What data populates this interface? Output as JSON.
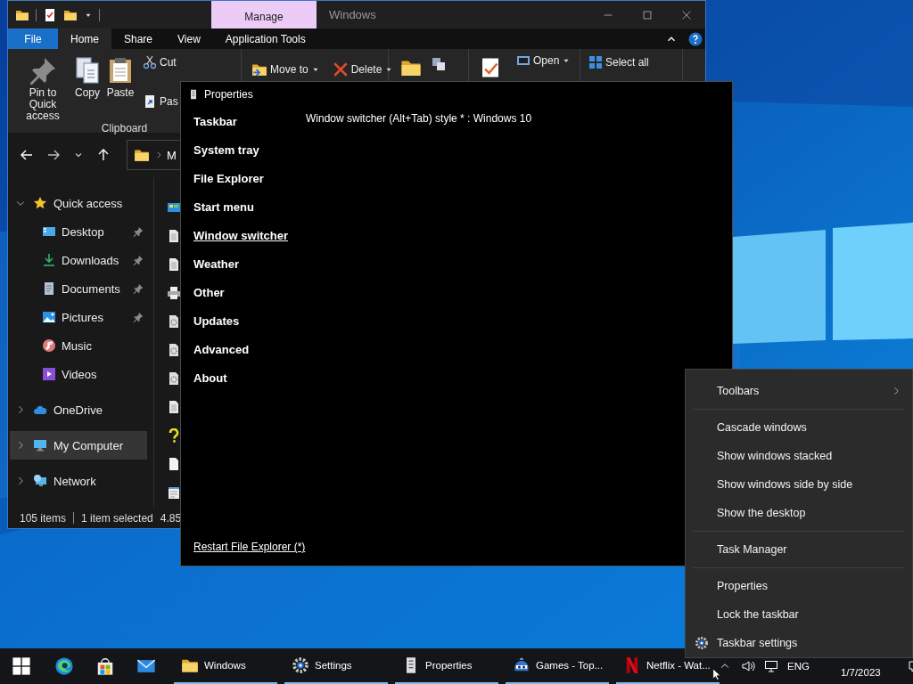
{
  "explorer": {
    "contextual_tab": "Manage",
    "title": "Windows",
    "ribbon_tabs": [
      {
        "label": "File",
        "kind": "file",
        "selected": false
      },
      {
        "label": "Home",
        "kind": "tab",
        "selected": true
      },
      {
        "label": "Share",
        "kind": "tab",
        "selected": false
      },
      {
        "label": "View",
        "kind": "tab",
        "selected": false
      },
      {
        "label": "Application Tools",
        "kind": "tab",
        "selected": false
      }
    ],
    "clipboard_group": {
      "large_buttons": [
        "Pin to Quick access",
        "Copy",
        "Paste"
      ],
      "small_buttons": [
        "Cut",
        "Pas"
      ],
      "label": "Clipboard"
    },
    "organize_buttons": [
      "Move to",
      "Delete"
    ],
    "open_buttons": [
      "Open"
    ],
    "select_buttons": [
      "Select all"
    ],
    "address": "M",
    "nav_tree": [
      {
        "label": "Quick access",
        "expanded": true,
        "selected": false,
        "children": [
          {
            "label": "Desktop",
            "pinned": true,
            "selected": false
          },
          {
            "label": "Downloads",
            "pinned": true,
            "selected": false
          },
          {
            "label": "Documents",
            "pinned": true,
            "selected": false
          },
          {
            "label": "Pictures",
            "pinned": true,
            "selected": false
          },
          {
            "label": "Music",
            "pinned": false,
            "selected": false
          },
          {
            "label": "Videos",
            "pinned": false,
            "selected": false
          }
        ]
      },
      {
        "label": "OneDrive",
        "expanded": false,
        "selected": false
      },
      {
        "label": "My Computer",
        "expanded": false,
        "selected": true
      },
      {
        "label": "Network",
        "expanded": false,
        "selected": false
      }
    ],
    "status": {
      "item_count": "105 items",
      "selection": "1 item selected",
      "size": "4.85"
    }
  },
  "properties": {
    "title": "Properties",
    "sections": [
      {
        "label": "Taskbar",
        "selected": false
      },
      {
        "label": "System tray",
        "selected": false
      },
      {
        "label": "File Explorer",
        "selected": false
      },
      {
        "label": "Start menu",
        "selected": false
      },
      {
        "label": "Window switcher",
        "selected": true
      },
      {
        "label": "Weather",
        "selected": false
      },
      {
        "label": "Other",
        "selected": false
      },
      {
        "label": "Updates",
        "selected": false
      },
      {
        "label": "Advanced",
        "selected": false
      },
      {
        "label": "About",
        "selected": false
      }
    ],
    "setting": "Window switcher (Alt+Tab) style * : Windows 10",
    "footer_link": "Restart File Explorer (*)"
  },
  "context_menu": {
    "groups": [
      {
        "items": [
          {
            "label": "Toolbars",
            "kind": "submenu"
          }
        ]
      },
      {
        "items": [
          {
            "label": "Cascade windows",
            "kind": "plain"
          },
          {
            "label": "Show windows stacked",
            "kind": "plain"
          },
          {
            "label": "Show windows side by side",
            "kind": "plain"
          },
          {
            "label": "Show the desktop",
            "kind": "plain"
          }
        ]
      },
      {
        "items": [
          {
            "label": "Task Manager",
            "kind": "plain"
          }
        ]
      },
      {
        "items": [
          {
            "label": "Properties",
            "kind": "plain"
          },
          {
            "label": "Lock the taskbar",
            "kind": "plain"
          },
          {
            "label": "Taskbar settings",
            "kind": "settings"
          }
        ]
      }
    ]
  },
  "taskbar": {
    "apps": [
      {
        "label": "Windows",
        "running": true
      },
      {
        "label": "Settings",
        "running": true
      },
      {
        "label": "Properties",
        "running": true
      },
      {
        "label": "Games - Top...",
        "running": true
      },
      {
        "label": "Netflix - Wat...",
        "running": true
      }
    ],
    "language": "ENG",
    "date": "1/7/2023"
  }
}
